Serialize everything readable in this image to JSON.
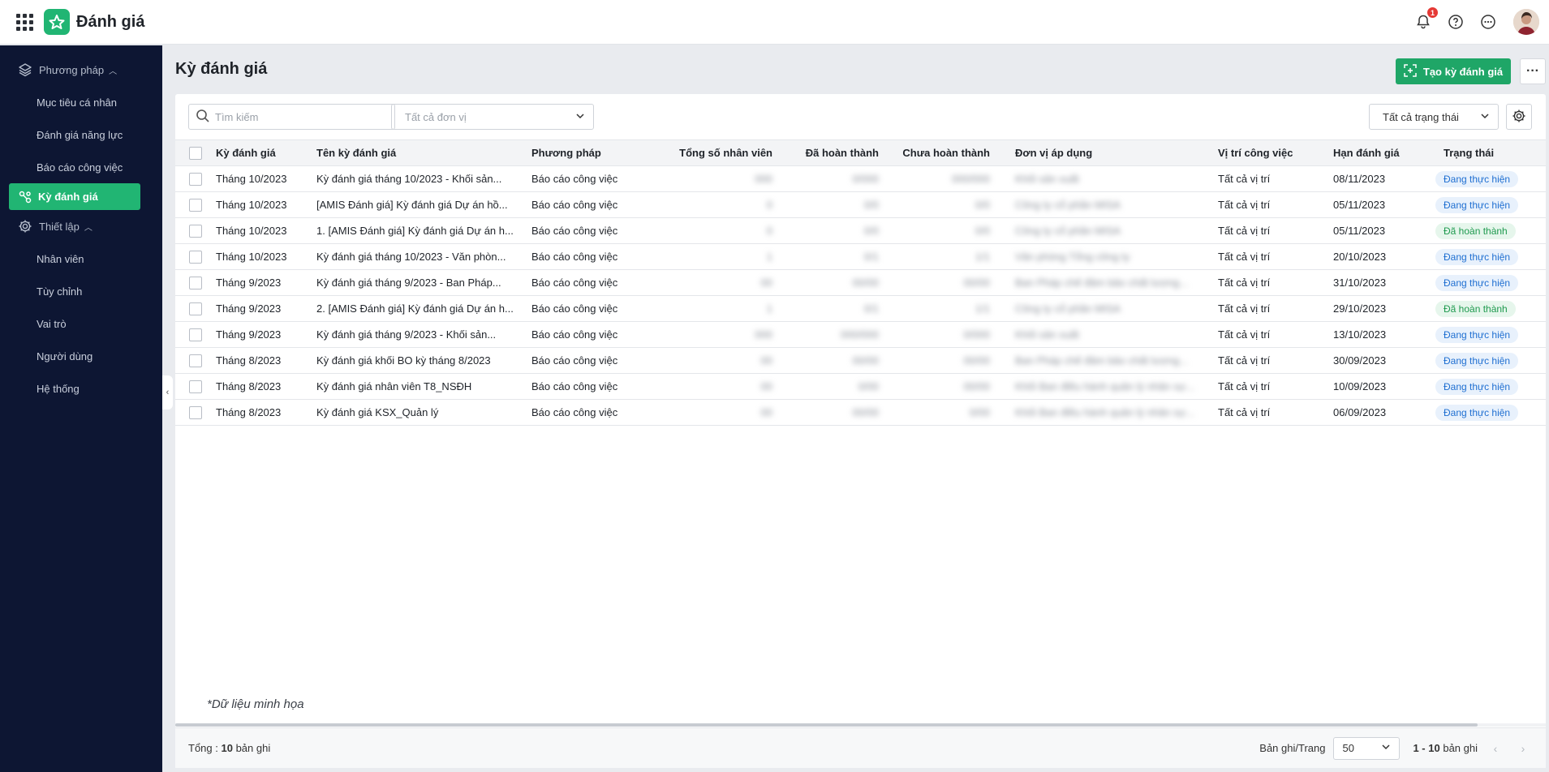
{
  "app": {
    "title": "Đánh giá",
    "notification_count": "1"
  },
  "sidebar": {
    "group_method": "Phương pháp",
    "method_items": [
      {
        "label": "Mục tiêu cá nhân"
      },
      {
        "label": "Đánh giá năng lực"
      },
      {
        "label": "Báo cáo công việc"
      }
    ],
    "active_item": "Kỳ đánh giá",
    "group_setup": "Thiết lập",
    "setup_items": [
      {
        "label": "Nhân viên"
      },
      {
        "label": "Tùy chỉnh"
      },
      {
        "label": "Vai trò"
      },
      {
        "label": "Người dùng"
      },
      {
        "label": "Hệ thống"
      }
    ]
  },
  "page": {
    "title": "Kỳ đánh giá",
    "create_button": "Tạo kỳ đánh giá"
  },
  "filters": {
    "search_placeholder": "Tìm kiếm",
    "unit_placeholder": "Tất cả đơn vị",
    "status_value": "Tất cả trạng thái"
  },
  "table": {
    "columns": [
      "Kỳ đánh giá",
      "Tên kỳ đánh giá",
      "Phương pháp",
      "Tổng số nhân viên",
      "Đã hoàn thành",
      "Chưa hoàn thành",
      "Đơn vị áp dụng",
      "Vị trí công việc",
      "Hạn đánh giá",
      "Trạng thái"
    ],
    "rows": [
      {
        "period": "Tháng 10/2023",
        "name": "Kỳ đánh giá tháng 10/2023 - Khối sản...",
        "method": "Báo cáo công việc",
        "total": "000",
        "done": "0/000",
        "pending": "000/000",
        "unit": "Khối sản xuất",
        "position": "Tất cả vị trí",
        "deadline": "08/11/2023",
        "status": "Đang thực hiện",
        "status_kind": "doing"
      },
      {
        "period": "Tháng 10/2023",
        "name": "[AMIS Đánh giá] Kỳ đánh giá Dự án hồ...",
        "method": "Báo cáo công việc",
        "total": "0",
        "done": "0/0",
        "pending": "0/0",
        "unit": "Công ty cổ phần MISA",
        "position": "Tất cả vị trí",
        "deadline": "05/11/2023",
        "status": "Đang thực hiện",
        "status_kind": "doing"
      },
      {
        "period": "Tháng 10/2023",
        "name": "1. [AMIS Đánh giá] Kỳ đánh giá Dự án h...",
        "method": "Báo cáo công việc",
        "total": "0",
        "done": "0/0",
        "pending": "0/0",
        "unit": "Công ty cổ phần MISA",
        "position": "Tất cả vị trí",
        "deadline": "05/11/2023",
        "status": "Đã hoàn thành",
        "status_kind": "done"
      },
      {
        "period": "Tháng 10/2023",
        "name": "Kỳ đánh giá tháng 10/2023 - Văn phòn...",
        "method": "Báo cáo công việc",
        "total": "1",
        "done": "0/1",
        "pending": "1/1",
        "unit": "Văn phòng Tổng công ty",
        "position": "Tất cả vị trí",
        "deadline": "20/10/2023",
        "status": "Đang thực hiện",
        "status_kind": "doing"
      },
      {
        "period": "Tháng 9/2023",
        "name": "Kỳ đánh giá tháng 9/2023 - Ban Pháp...",
        "method": "Báo cáo công việc",
        "total": "00",
        "done": "00/00",
        "pending": "00/00",
        "unit": "Ban Pháp chế đảm bảo chất lượng...",
        "position": "Tất cả vị trí",
        "deadline": "31/10/2023",
        "status": "Đang thực hiện",
        "status_kind": "doing"
      },
      {
        "period": "Tháng 9/2023",
        "name": "2. [AMIS Đánh giá] Kỳ đánh giá Dự án h...",
        "method": "Báo cáo công việc",
        "total": "1",
        "done": "0/1",
        "pending": "1/1",
        "unit": "Công ty cổ phần MISA",
        "position": "Tất cả vị trí",
        "deadline": "29/10/2023",
        "status": "Đã hoàn thành",
        "status_kind": "done"
      },
      {
        "period": "Tháng 9/2023",
        "name": "Kỳ đánh giá tháng 9/2023 - Khối sản...",
        "method": "Báo cáo công việc",
        "total": "000",
        "done": "000/000",
        "pending": "0/000",
        "unit": "Khối sản xuất",
        "position": "Tất cả vị trí",
        "deadline": "13/10/2023",
        "status": "Đang thực hiện",
        "status_kind": "doing"
      },
      {
        "period": "Tháng 8/2023",
        "name": "Kỳ đánh giá khối BO kỳ tháng 8/2023",
        "method": "Báo cáo công việc",
        "total": "00",
        "done": "00/00",
        "pending": "00/00",
        "unit": "Ban Pháp chế đảm bảo chất lượng...",
        "position": "Tất cả vị trí",
        "deadline": "30/09/2023",
        "status": "Đang thực hiện",
        "status_kind": "doing"
      },
      {
        "period": "Tháng 8/2023",
        "name": "Kỳ đánh giá nhân viên T8_NSĐH",
        "method": "Báo cáo công việc",
        "total": "00",
        "done": "0/00",
        "pending": "00/00",
        "unit": "Khối Ban điều hành quản lý nhân sự...",
        "position": "Tất cả vị trí",
        "deadline": "10/09/2023",
        "status": "Đang thực hiện",
        "status_kind": "doing"
      },
      {
        "period": "Tháng 8/2023",
        "name": "Kỳ đánh giá KSX_Quản lý",
        "method": "Báo cáo công việc",
        "total": "00",
        "done": "00/00",
        "pending": "0/00",
        "unit": "Khối Ban điều hành quản lý nhân sự...",
        "position": "Tất cả vị trí",
        "deadline": "06/09/2023",
        "status": "Đang thực hiện",
        "status_kind": "doing"
      }
    ]
  },
  "note": "*Dữ liệu minh họa",
  "footer": {
    "total_label": "Tổng :",
    "total_count": "10",
    "total_suffix": "bản ghi",
    "page_size_label": "Bản ghi/Trang",
    "page_size": "50",
    "range": "1 - 10",
    "range_suffix": "bản ghi"
  },
  "colors": {
    "brand_green": "#21b573",
    "sidebar_bg": "#0d1633",
    "status_doing": "#1f6fd1",
    "status_done": "#1f9a4f"
  }
}
